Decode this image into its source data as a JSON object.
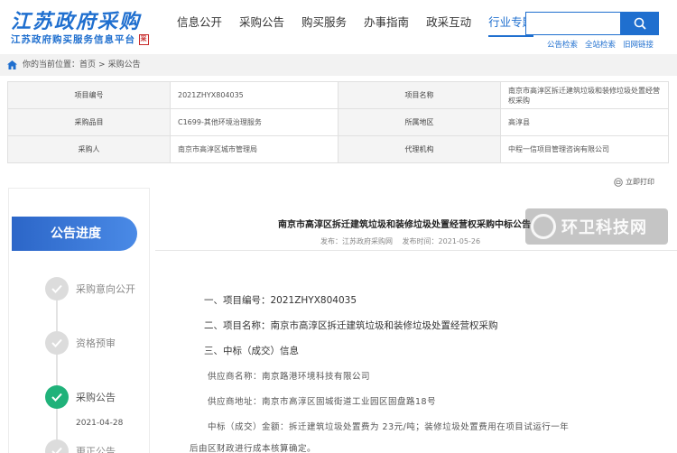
{
  "header": {
    "logo_main": "江苏政府采购",
    "logo_sub": "江苏政府购买服务信息平台",
    "logo_seal": "采",
    "nav": [
      "信息公开",
      "采购公告",
      "购买服务",
      "办事指南",
      "政采互动",
      "行业专题"
    ],
    "active_nav": "行业专题",
    "search_placeholder": "",
    "quick_links": [
      "公告检索",
      "全站检索",
      "旧网链接"
    ]
  },
  "breadcrumb": {
    "prefix": "你的当前位置：",
    "home": "首页",
    "sep": ">",
    "current": "采购公告"
  },
  "info_table": {
    "rows": [
      {
        "l1": "项目编号",
        "v1": "2021ZHYX804035",
        "l2": "项目名称",
        "v2": "南京市高淳区拆迁建筑垃圾和装修垃圾处置经营权采购"
      },
      {
        "l1": "采购品目",
        "v1": "C1699-其他环境治理服务",
        "l2": "所属地区",
        "v2": "高淳县"
      },
      {
        "l1": "采购人",
        "v1": "南京市高淳区城市管理局",
        "l2": "代理机构",
        "v2": "中程一信项目管理咨询有限公司"
      }
    ]
  },
  "print_label": "立即打印",
  "progress": {
    "title": "公告进度",
    "steps": [
      {
        "label": "采购意向公开",
        "done": false,
        "date": ""
      },
      {
        "label": "资格预审",
        "done": false,
        "date": ""
      },
      {
        "label": "采购公告",
        "done": true,
        "date": "2021-04-28"
      },
      {
        "label": "更正公告",
        "done": false,
        "date": ""
      }
    ]
  },
  "document": {
    "title": "南京市高淳区拆迁建筑垃圾和装修垃圾处置经营权采购中标公告",
    "publisher": "发布：江苏政府采购网",
    "published_at": "发布时间：2021-05-26",
    "lines": [
      "一、项目编号：2021ZHYX804035",
      "二、项目名称：南京市高淳区拆迁建筑垃圾和装修垃圾处置经营权采购",
      "三、中标（成交）信息",
      "供应商名称：南京路港环境科技有限公司",
      "供应商地址：南京市高淳区固城街道工业园区固盘路18号",
      "中标（成交）金额：拆迁建筑垃圾处置费为 23元/吨；装修垃圾处置费用在项目试运行一年",
      "后由区财政进行成本核算确定。"
    ]
  },
  "watermark": "环卫科技网",
  "colors": {
    "brand": "#1f6fcf",
    "progress_title_bg": "#2c66c8",
    "step_done": "#20b27a",
    "step_pending": "#dcdcdc"
  }
}
